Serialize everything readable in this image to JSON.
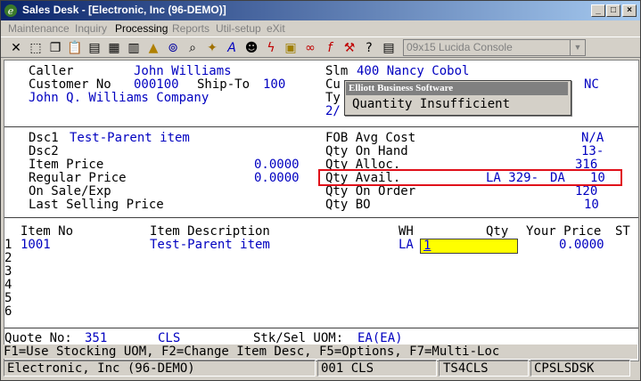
{
  "window": {
    "title": "Sales Desk - [Electronic, Inc (96-DEMO)]"
  },
  "menu": [
    "Maintenance",
    "Inquiry",
    "Processing",
    "Reports",
    "Util-setup",
    "eXit"
  ],
  "toolbar": {
    "font_selector": "09x15 Lucida Console"
  },
  "header": {
    "caller_label": "Caller",
    "caller": "John Williams",
    "customer_label": "Customer No",
    "customer_no": "000100",
    "shipto_label": "Ship-To",
    "shipto": "100",
    "company": "John Q. Williams Company",
    "slm_label": "Slm",
    "slm": "400 Nancy Cobol",
    "cu_label": "Cu",
    "ty_label": "Ty",
    "date_partial": "2/",
    "right_partial": "NC"
  },
  "popup": {
    "title": "Elliott Business Software",
    "message": "Quantity Insufficient"
  },
  "item_info": {
    "dsc1_label": "Dsc1",
    "dsc1": "Test-Parent item",
    "dsc2_label": "Dsc2",
    "item_price_label": "Item Price",
    "item_price": "0.0000",
    "regular_price_label": "Regular Price",
    "regular_price": "0.0000",
    "on_sale_label": "On Sale/Exp",
    "last_selling_label": "Last Selling Price",
    "fob_label": "FOB Avg Cost",
    "fob": "N/A",
    "on_hand_label": "Qty On Hand",
    "on_hand": "13-",
    "alloc_label": "Qty Alloc.",
    "alloc": "316",
    "avail_label": "Qty Avail.",
    "avail_loc": "LA 329-",
    "avail_da": "DA",
    "avail_da_value": "10",
    "on_order_label": "Qty On Order",
    "on_order": "120",
    "bo_label": "Qty BO",
    "bo": "10"
  },
  "grid": {
    "headers": {
      "item_no": "Item No",
      "description": "Item Description",
      "wh": "WH",
      "qty": "Qty",
      "price": "Your Price",
      "st": "ST"
    },
    "row_numbers": [
      "1",
      "2",
      "3",
      "4",
      "5",
      "6"
    ],
    "row1": {
      "item_no": "1001",
      "description": "Test-Parent item",
      "wh": "LA",
      "qty": "1",
      "price": "0.0000"
    }
  },
  "footer": {
    "quote_label": "Quote No:",
    "quote_no": "351",
    "cls": "CLS",
    "stk_label": "Stk/Sel UOM:",
    "uom": "EA(EA)",
    "fkeys": "F1=Use Stocking UOM, F2=Change Item Desc, F5=Options, F7=Multi-Loc"
  },
  "status": {
    "company": "Electronic, Inc (96-DEMO)",
    "cls": "001 CLS",
    "terminal": "TS4CLS",
    "program": "CPSLSDSK"
  }
}
